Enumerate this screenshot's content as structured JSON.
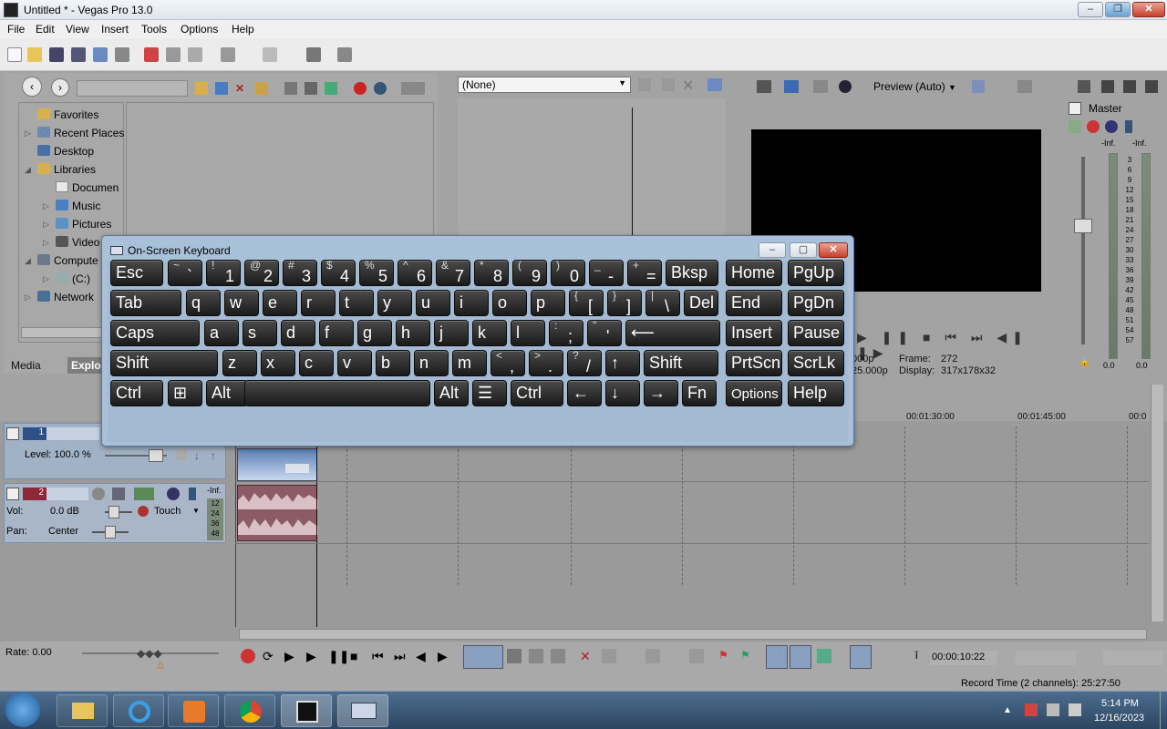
{
  "window": {
    "title": "Untitled * - Vegas Pro 13.0"
  },
  "menu": [
    "File",
    "Edit",
    "View",
    "Insert",
    "Tools",
    "Options",
    "Help"
  ],
  "explorer": {
    "tree": [
      {
        "label": "Favorites"
      },
      {
        "label": "Recent Places"
      },
      {
        "label": "Desktop"
      },
      {
        "label": "Libraries"
      },
      {
        "label": "Documen"
      },
      {
        "label": "Music"
      },
      {
        "label": "Pictures"
      },
      {
        "label": "Video"
      },
      {
        "label": "Compute"
      },
      {
        "label": "(C:)"
      },
      {
        "label": "Network"
      }
    ],
    "tabs": [
      "Media",
      "Explo"
    ]
  },
  "trimmer": {
    "dropdown_value": "(None)"
  },
  "preview": {
    "mode": "Preview (Auto)",
    "project": "000p",
    "preview_info": "25.000p",
    "frame_label": "Frame:",
    "frame_value": "272",
    "display_label": "Display:",
    "display_value": "317x178x32"
  },
  "master": {
    "label": "Master",
    "inf_left": "-Inf.",
    "inf_right": "-Inf.",
    "scale": [
      "3",
      "6",
      "9",
      "12",
      "15",
      "18",
      "21",
      "24",
      "27",
      "30",
      "33",
      "36",
      "39",
      "42",
      "45",
      "48",
      "51",
      "54",
      "57"
    ],
    "val_left": "0.0",
    "val_right": "0.0"
  },
  "keyboard": {
    "title": "On-Screen Keyboard",
    "rows": [
      [
        {
          "main": "Esc"
        },
        {
          "shift": "~",
          "main": "`"
        },
        {
          "shift": "!",
          "main": "1"
        },
        {
          "shift": "@",
          "main": "2"
        },
        {
          "shift": "#",
          "main": "3"
        },
        {
          "shift": "$",
          "main": "4"
        },
        {
          "shift": "%",
          "main": "5"
        },
        {
          "shift": "^",
          "main": "6"
        },
        {
          "shift": "&",
          "main": "7"
        },
        {
          "shift": "*",
          "main": "8"
        },
        {
          "shift": "(",
          "main": "9"
        },
        {
          "shift": ")",
          "main": "0"
        },
        {
          "shift": "_",
          "main": "-"
        },
        {
          "shift": "+",
          "main": "="
        },
        {
          "main": "Bksp"
        },
        {
          "main": "Home"
        },
        {
          "main": "PgUp"
        }
      ],
      [
        {
          "main": "Tab"
        },
        {
          "main": "q"
        },
        {
          "main": "w"
        },
        {
          "main": "e"
        },
        {
          "main": "r"
        },
        {
          "main": "t"
        },
        {
          "main": "y"
        },
        {
          "main": "u"
        },
        {
          "main": "i"
        },
        {
          "main": "o"
        },
        {
          "main": "p"
        },
        {
          "shift": "{",
          "main": "["
        },
        {
          "shift": "}",
          "main": "]"
        },
        {
          "shift": "|",
          "main": "\\"
        },
        {
          "main": "Del"
        },
        {
          "main": "End"
        },
        {
          "main": "PgDn"
        }
      ],
      [
        {
          "main": "Caps"
        },
        {
          "main": "a"
        },
        {
          "main": "s"
        },
        {
          "main": "d"
        },
        {
          "main": "f"
        },
        {
          "main": "g"
        },
        {
          "main": "h"
        },
        {
          "main": "j"
        },
        {
          "main": "k"
        },
        {
          "main": "l"
        },
        {
          "shift": ":",
          "main": ";"
        },
        {
          "shift": "\"",
          "main": "'"
        },
        {
          "main": "⟵"
        },
        {
          "main": "Insert"
        },
        {
          "main": "Pause"
        }
      ],
      [
        {
          "main": "Shift"
        },
        {
          "main": "z"
        },
        {
          "main": "x"
        },
        {
          "main": "c"
        },
        {
          "main": "v"
        },
        {
          "main": "b"
        },
        {
          "main": "n"
        },
        {
          "main": "m"
        },
        {
          "shift": "<",
          "main": ","
        },
        {
          "shift": ">",
          "main": "."
        },
        {
          "shift": "?",
          "main": "/"
        },
        {
          "main": "↑"
        },
        {
          "main": "Shift"
        },
        {
          "main": "PrtScn"
        },
        {
          "main": "ScrLk"
        }
      ],
      [
        {
          "main": "Ctrl"
        },
        {
          "main": "⊞"
        },
        {
          "main": "Alt"
        },
        {
          "main": ""
        },
        {
          "main": "Alt"
        },
        {
          "main": "☰"
        },
        {
          "main": "Ctrl"
        },
        {
          "main": "←"
        },
        {
          "main": "↓"
        },
        {
          "main": "→"
        },
        {
          "main": "Fn"
        },
        {
          "main": "Options"
        },
        {
          "main": "Help"
        }
      ]
    ]
  },
  "tracks": {
    "video": {
      "number": "1",
      "level": "Level: 100.0 %"
    },
    "audio": {
      "number": "2",
      "vol_label": "Vol:",
      "vol_value": "0.0 dB",
      "pan_label": "Pan:",
      "pan_value": "Center",
      "mode": "Touch",
      "inf": "-Inf.",
      "scale": [
        "12",
        "24",
        "36",
        "48"
      ]
    }
  },
  "ruler": [
    "00:01:30:00",
    "00:01:45:00",
    "00:0"
  ],
  "transport": {
    "rate": "Rate: 0.00",
    "timecode": "00:00:10:22"
  },
  "status": {
    "record_time": "Record Time (2 channels): 25:27:50"
  },
  "taskbar": {
    "time": "5:14 PM",
    "date": "12/16/2023"
  }
}
